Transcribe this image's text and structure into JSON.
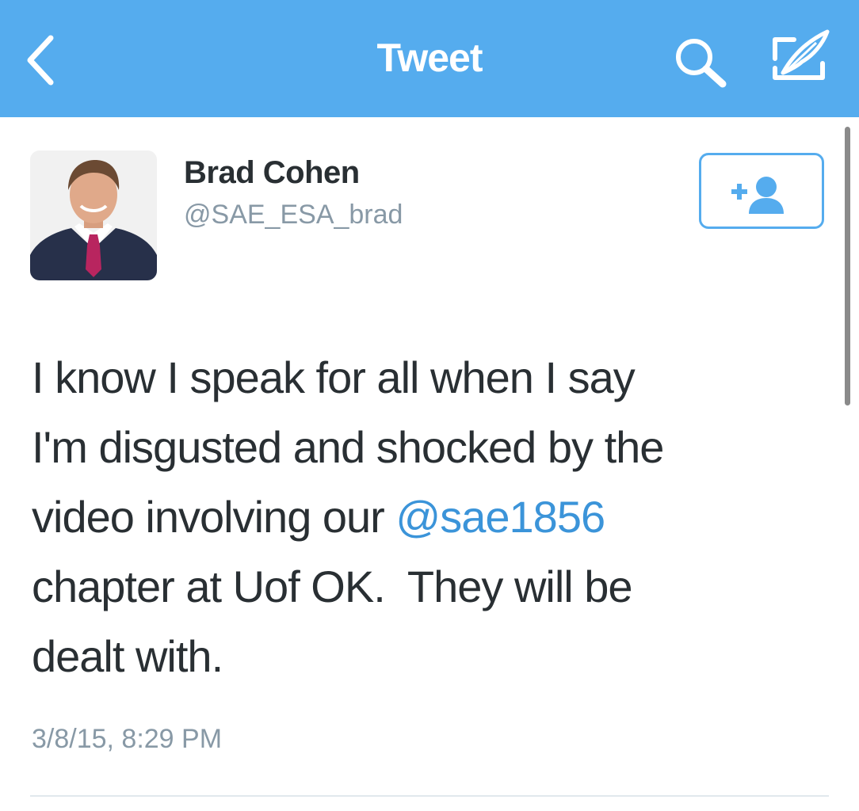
{
  "navbar": {
    "title": "Tweet",
    "background_color": "#55acee",
    "back_icon": "chevron-left-icon",
    "search_icon": "search-icon",
    "compose_icon": "compose-icon"
  },
  "tweet": {
    "author": {
      "name": "Brad Cohen",
      "handle": "@SAE_ESA_brad"
    },
    "follow_button_icon": "add-user-icon",
    "text_lines": [
      {
        "text": "I know I speak for all when I say"
      },
      {
        "text": "I'm disgusted and shocked by the"
      },
      {
        "before": "video involving our ",
        "mention": "@sae1856"
      },
      {
        "text": "chapter at Uof OK.  They will be"
      },
      {
        "text": "dealt with."
      }
    ],
    "timestamp": "3/8/15, 8:29 PM"
  },
  "colors": {
    "accent": "#55acee",
    "mention": "#3b94d9",
    "text": "#292f33",
    "secondary_text": "#8899a6"
  }
}
